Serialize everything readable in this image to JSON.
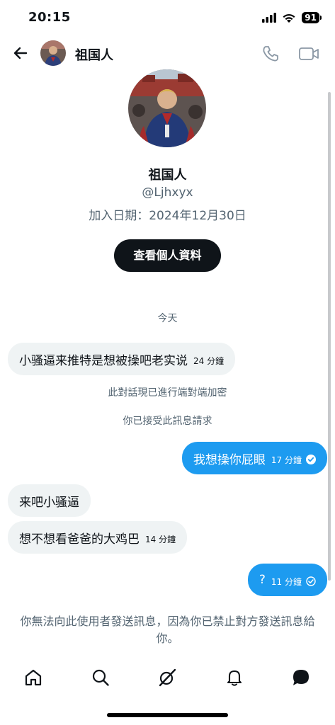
{
  "status_bar": {
    "time": "20:15",
    "battery": "91"
  },
  "header": {
    "name": "祖国人"
  },
  "profile": {
    "name": "祖国人",
    "handle": "@Ljhxyx",
    "joined": "加入日期：2024年12月30日",
    "view_profile_label": "查看個人資料"
  },
  "conversation": {
    "date_label": "今天",
    "encryption_note": "此對話現已進行端對端加密",
    "accepted_note": "你已接受此訊息請求",
    "messages": [
      {
        "text": "小骚逼来推特是想被操吧老实说",
        "time": "24 分鐘",
        "direction": "incoming"
      },
      {
        "text": "我想操你屁眼",
        "time": "17 分鐘",
        "direction": "outgoing"
      },
      {
        "text": "来吧小骚逼",
        "time": "",
        "direction": "incoming"
      },
      {
        "text": "想不想看爸爸的大鸡巴",
        "time": "14 分鐘",
        "direction": "incoming"
      },
      {
        "text": "?",
        "time": "11 分鐘",
        "direction": "outgoing"
      }
    ],
    "blocked_note": "你無法向此使用者發送訊息，因為你已禁止對方發送訊息給你。"
  },
  "nav": {
    "items": [
      "home-icon",
      "search-icon",
      "grok-icon",
      "notifications-icon",
      "messages-icon"
    ]
  },
  "colors": {
    "accent": "#1d9bf0",
    "text": "#0f1419",
    "muted": "#536471",
    "bubble_incoming": "#eff3f4"
  }
}
